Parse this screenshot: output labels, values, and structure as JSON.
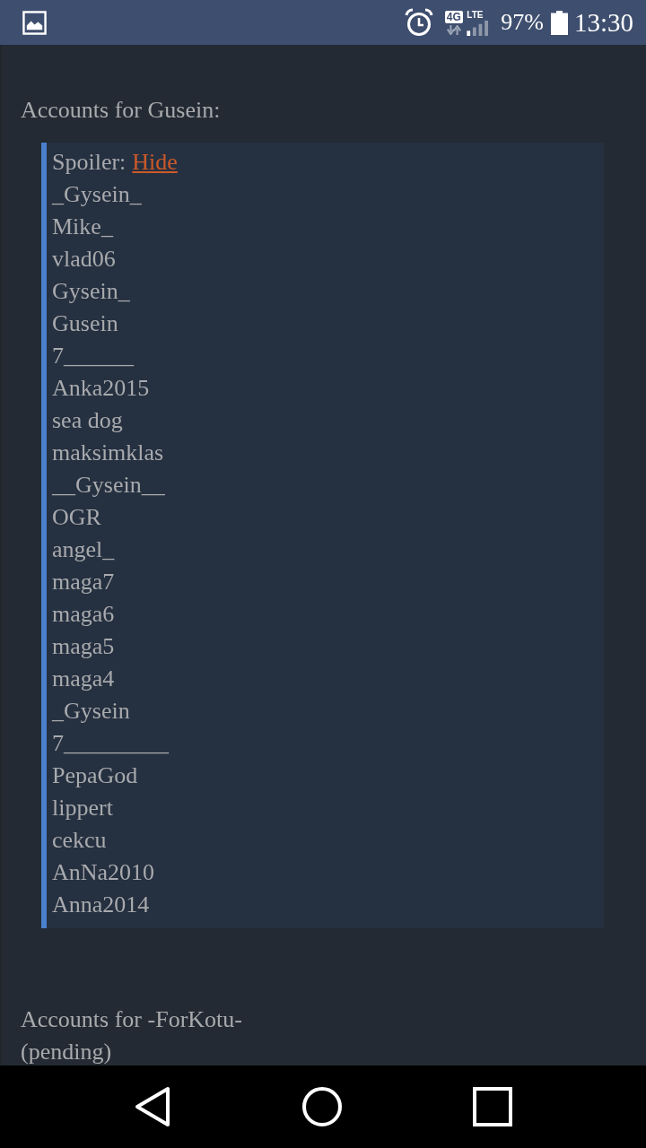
{
  "status_bar": {
    "network_type": "4G",
    "network_label": "LTE",
    "battery": "97%",
    "time": "13:30"
  },
  "sections": [
    {
      "heading": "Accounts for Gusein:",
      "spoiler": {
        "label": "Spoiler:",
        "toggle": "Hide",
        "accounts": [
          "_Gysein_",
          "Mike_",
          "vlad06",
          "Gysein_",
          "Gusein",
          "7______",
          "Anka2015",
          "sea dog",
          "maksimklas",
          "__Gysein__",
          "OGR",
          "angel_",
          "maga7",
          "maga6",
          "maga5",
          "maga4",
          "_Gysein",
          "7_________",
          "PepaGod",
          "lippert",
          "cekcu",
          "AnNa2010",
          "Anna2014"
        ]
      }
    },
    {
      "heading": "Accounts for -ForKotu- (pending)"
    }
  ]
}
